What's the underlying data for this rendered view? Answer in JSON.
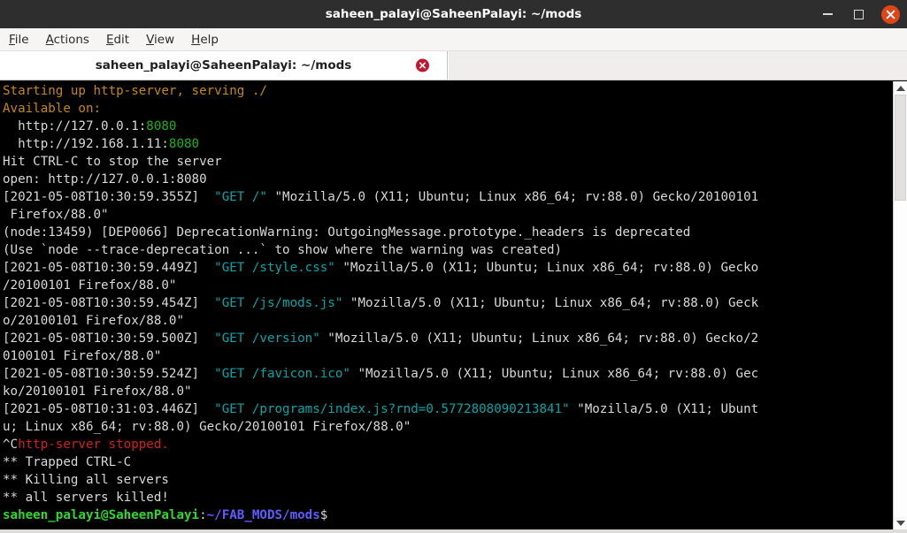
{
  "window": {
    "title": "saheen_palayi@SaheenPalayi: ~/mods",
    "controls": {
      "minimize": "minimize-button",
      "maximize": "maximize-button",
      "close": "close-button"
    }
  },
  "menubar": {
    "items": [
      {
        "label": "File",
        "mnemonic": "F"
      },
      {
        "label": "Actions",
        "mnemonic": "A"
      },
      {
        "label": "Edit",
        "mnemonic": "E"
      },
      {
        "label": "View",
        "mnemonic": "V"
      },
      {
        "label": "Help",
        "mnemonic": "H"
      }
    ]
  },
  "tabs": [
    {
      "title": "saheen_palayi@SaheenPalayi: ~/mods",
      "active": true,
      "close_label": "x"
    }
  ],
  "colors": {
    "background": "#000000",
    "foreground": "#d8d8d8",
    "orange": "#c4890c",
    "green": "#18b218",
    "cyan": "#00a6a6",
    "red": "#d22020",
    "prompt_user": "#2fd72f",
    "prompt_path": "#5c5cff",
    "titlebar": "#2e2e2e",
    "close_button": "#e0451a",
    "tab_close": "#c3152d"
  },
  "terminal": {
    "lines": [
      {
        "id": "l01",
        "segs": [
          {
            "t": "Starting up http-server, serving ./",
            "c": "c-orange"
          }
        ]
      },
      {
        "id": "l02",
        "segs": [
          {
            "t": "Available on:",
            "c": "c-orange"
          }
        ]
      },
      {
        "id": "l03",
        "segs": [
          {
            "t": "  http://127.0.0.1:",
            "c": "c-white"
          },
          {
            "t": "8080",
            "c": "c-green"
          }
        ]
      },
      {
        "id": "l04",
        "segs": [
          {
            "t": "  http://192.168.1.11:",
            "c": "c-white"
          },
          {
            "t": "8080",
            "c": "c-green"
          }
        ]
      },
      {
        "id": "l05",
        "segs": [
          {
            "t": "Hit CTRL-C to stop the server",
            "c": "c-white"
          }
        ]
      },
      {
        "id": "l06",
        "segs": [
          {
            "t": "open: http://127.0.0.1:8080",
            "c": "c-white"
          }
        ]
      },
      {
        "id": "l07",
        "segs": [
          {
            "t": "[2021-05-08T10:30:59.355Z]  ",
            "c": "c-white"
          },
          {
            "t": "\"GET /\"",
            "c": "c-cyan"
          },
          {
            "t": " \"Mozilla/5.0 (X11; Ubuntu; Linux x86_64; rv:88.0) Gecko/20100101",
            "c": "c-white"
          }
        ]
      },
      {
        "id": "l08",
        "segs": [
          {
            "t": " Firefox/88.0\"",
            "c": "c-white"
          }
        ]
      },
      {
        "id": "l09",
        "segs": [
          {
            "t": "(node:13459) [DEP0066] DeprecationWarning: OutgoingMessage.prototype._headers is deprecated",
            "c": "c-white"
          }
        ]
      },
      {
        "id": "l10",
        "segs": [
          {
            "t": "(Use `node --trace-deprecation ...` to show where the warning was created)",
            "c": "c-white"
          }
        ]
      },
      {
        "id": "l11",
        "segs": [
          {
            "t": "[2021-05-08T10:30:59.449Z]  ",
            "c": "c-white"
          },
          {
            "t": "\"GET /style.css\"",
            "c": "c-cyan"
          },
          {
            "t": " \"Mozilla/5.0 (X11; Ubuntu; Linux x86_64; rv:88.0) Gecko",
            "c": "c-white"
          }
        ]
      },
      {
        "id": "l12",
        "segs": [
          {
            "t": "/20100101 Firefox/88.0\"",
            "c": "c-white"
          }
        ]
      },
      {
        "id": "l13",
        "segs": [
          {
            "t": "[2021-05-08T10:30:59.454Z]  ",
            "c": "c-white"
          },
          {
            "t": "\"GET /js/mods.js\"",
            "c": "c-cyan"
          },
          {
            "t": " \"Mozilla/5.0 (X11; Ubuntu; Linux x86_64; rv:88.0) Geck",
            "c": "c-white"
          }
        ]
      },
      {
        "id": "l14",
        "segs": [
          {
            "t": "o/20100101 Firefox/88.0\"",
            "c": "c-white"
          }
        ]
      },
      {
        "id": "l15",
        "segs": [
          {
            "t": "[2021-05-08T10:30:59.500Z]  ",
            "c": "c-white"
          },
          {
            "t": "\"GET /version\"",
            "c": "c-cyan"
          },
          {
            "t": " \"Mozilla/5.0 (X11; Ubuntu; Linux x86_64; rv:88.0) Gecko/2",
            "c": "c-white"
          }
        ]
      },
      {
        "id": "l16",
        "segs": [
          {
            "t": "0100101 Firefox/88.0\"",
            "c": "c-white"
          }
        ]
      },
      {
        "id": "l17",
        "segs": [
          {
            "t": "[2021-05-08T10:30:59.524Z]  ",
            "c": "c-white"
          },
          {
            "t": "\"GET /favicon.ico\"",
            "c": "c-cyan"
          },
          {
            "t": " \"Mozilla/5.0 (X11; Ubuntu; Linux x86_64; rv:88.0) Gec",
            "c": "c-white"
          }
        ]
      },
      {
        "id": "l18",
        "segs": [
          {
            "t": "ko/20100101 Firefox/88.0\"",
            "c": "c-white"
          }
        ]
      },
      {
        "id": "l19",
        "segs": [
          {
            "t": "[2021-05-08T10:31:03.446Z]  ",
            "c": "c-white"
          },
          {
            "t": "\"GET /programs/index.js?rnd=0.5772808090213841\"",
            "c": "c-cyan"
          },
          {
            "t": " \"Mozilla/5.0 (X11; Ubunt",
            "c": "c-white"
          }
        ]
      },
      {
        "id": "l20",
        "segs": [
          {
            "t": "u; Linux x86_64; rv:88.0) Gecko/20100101 Firefox/88.0\"",
            "c": "c-white"
          }
        ]
      },
      {
        "id": "l21",
        "segs": [
          {
            "t": "^C",
            "c": "c-white"
          },
          {
            "t": "http-server stopped.",
            "c": "c-red"
          }
        ]
      },
      {
        "id": "l22",
        "segs": [
          {
            "t": "** Trapped CTRL-C",
            "c": "c-white"
          }
        ]
      },
      {
        "id": "l23",
        "segs": [
          {
            "t": "** Killing all servers",
            "c": "c-white"
          }
        ]
      },
      {
        "id": "l24",
        "segs": [
          {
            "t": "** all servers killed!",
            "c": "c-white"
          }
        ]
      },
      {
        "id": "l25",
        "segs": [
          {
            "t": "saheen_palayi@SaheenPalayi",
            "c": "b-green"
          },
          {
            "t": ":",
            "c": "c-white"
          },
          {
            "t": "~/FAB_MODS/mods",
            "c": "b-blue"
          },
          {
            "t": "$",
            "c": "c-white"
          }
        ]
      }
    ]
  },
  "scrollbar": {
    "up_arrow": "scroll-up",
    "down_arrow": "scroll-down",
    "thumb": "scroll-thumb"
  }
}
